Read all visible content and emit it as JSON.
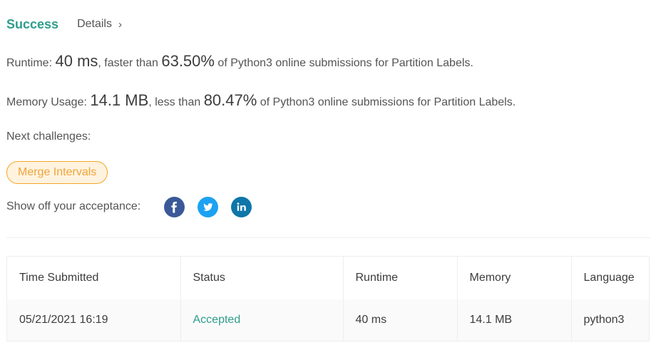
{
  "result": {
    "status": "Success",
    "details_label": "Details"
  },
  "runtime": {
    "label": "Runtime:",
    "value": "40 ms",
    "comparison": ", faster than ",
    "percent": "63.50%",
    "suffix": " of Python3 online submissions for Partition Labels."
  },
  "memory": {
    "label": "Memory Usage:",
    "value": "14.1 MB",
    "comparison": ", less than ",
    "percent": "80.47%",
    "suffix": " of Python3 online submissions for Partition Labels."
  },
  "next_challenges": {
    "label": "Next challenges:",
    "items": [
      "Merge Intervals"
    ]
  },
  "share": {
    "label": "Show off your acceptance:",
    "icons": [
      "facebook-icon",
      "twitter-icon",
      "linkedin-icon"
    ]
  },
  "submissions": {
    "columns": [
      "Time Submitted",
      "Status",
      "Runtime",
      "Memory",
      "Language"
    ],
    "rows": [
      {
        "time": "05/21/2021 16:19",
        "status": "Accepted",
        "runtime": "40 ms",
        "memory": "14.1 MB",
        "language": "python3"
      }
    ]
  },
  "colors": {
    "success": "#2e9e8c",
    "challenge_border": "#f5a623",
    "challenge_text": "#f0a43a",
    "facebook": "#3b5998",
    "twitter": "#1da1f2",
    "linkedin": "#0e76a8"
  }
}
